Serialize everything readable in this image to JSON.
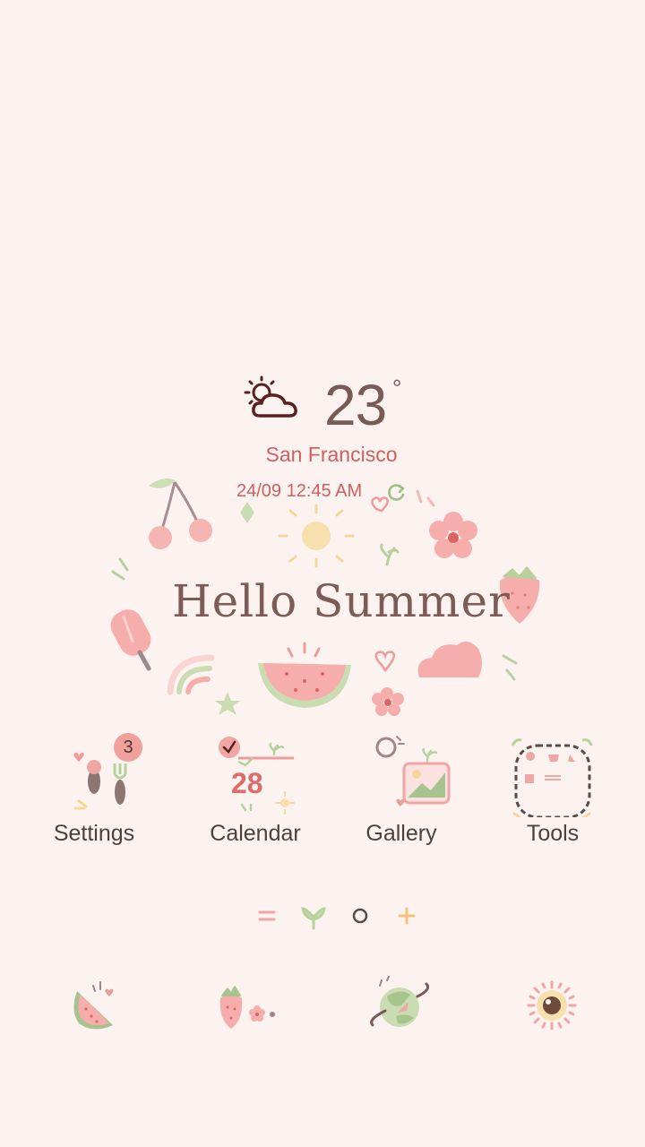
{
  "weather": {
    "temperature": "23",
    "degree_symbol": "°",
    "city": "San Francisco",
    "datetime": "24/09 12:45 AM",
    "icon": "partly-cloudy-icon"
  },
  "banner": {
    "text": "Hello Summer"
  },
  "apps": [
    {
      "label": "Settings",
      "icon": "settings-icon",
      "badge": "3"
    },
    {
      "label": "Calendar",
      "icon": "calendar-icon",
      "date": "28"
    },
    {
      "label": "Gallery",
      "icon": "gallery-icon"
    },
    {
      "label": "Tools",
      "icon": "folder-icon"
    }
  ],
  "page_indicator": {
    "items": [
      "menu-icon",
      "home-sprout-icon",
      "page-dot-icon",
      "add-page-icon"
    ],
    "current": 1
  },
  "dock": [
    {
      "icon": "phone-watermelon-icon"
    },
    {
      "icon": "contacts-strawberry-icon"
    },
    {
      "icon": "browser-planet-icon"
    },
    {
      "icon": "camera-sun-icon"
    }
  ],
  "colors": {
    "background": "#fcf3f1",
    "text_dark": "#4c4040",
    "accent_red": "#d05f5f",
    "pink": "#f1a09b",
    "green": "#a8c48e",
    "yellow": "#f4d89a"
  }
}
